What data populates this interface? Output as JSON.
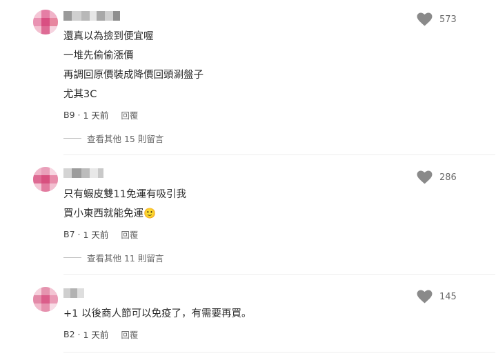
{
  "comments": [
    {
      "lines": [
        "還真以為撿到便宜喔",
        "一堆先偷偷漲價",
        "再調回原價裝成降價回頭涮盤子",
        "尤其3C"
      ],
      "floor": "B9",
      "time": "1 天前",
      "reply": "回覆",
      "likes": "573",
      "more": "查看其他 15 則留言"
    },
    {
      "lines": [
        "只有蝦皮雙11免運有吸引我",
        "買小東西就能免運🙂"
      ],
      "floor": "B7",
      "time": "1 天前",
      "reply": "回覆",
      "likes": "286",
      "more": "查看其他 11 則留言"
    },
    {
      "lines": [
        "+1 以後商人節可以免疫了，有需要再買。"
      ],
      "floor": "B2",
      "time": "1 天前",
      "reply": "回覆",
      "likes": "145"
    }
  ],
  "icons": {
    "like": "heart-icon"
  },
  "colors": {
    "heart": "#8a8a8a",
    "avatar": "#e07aa0"
  }
}
